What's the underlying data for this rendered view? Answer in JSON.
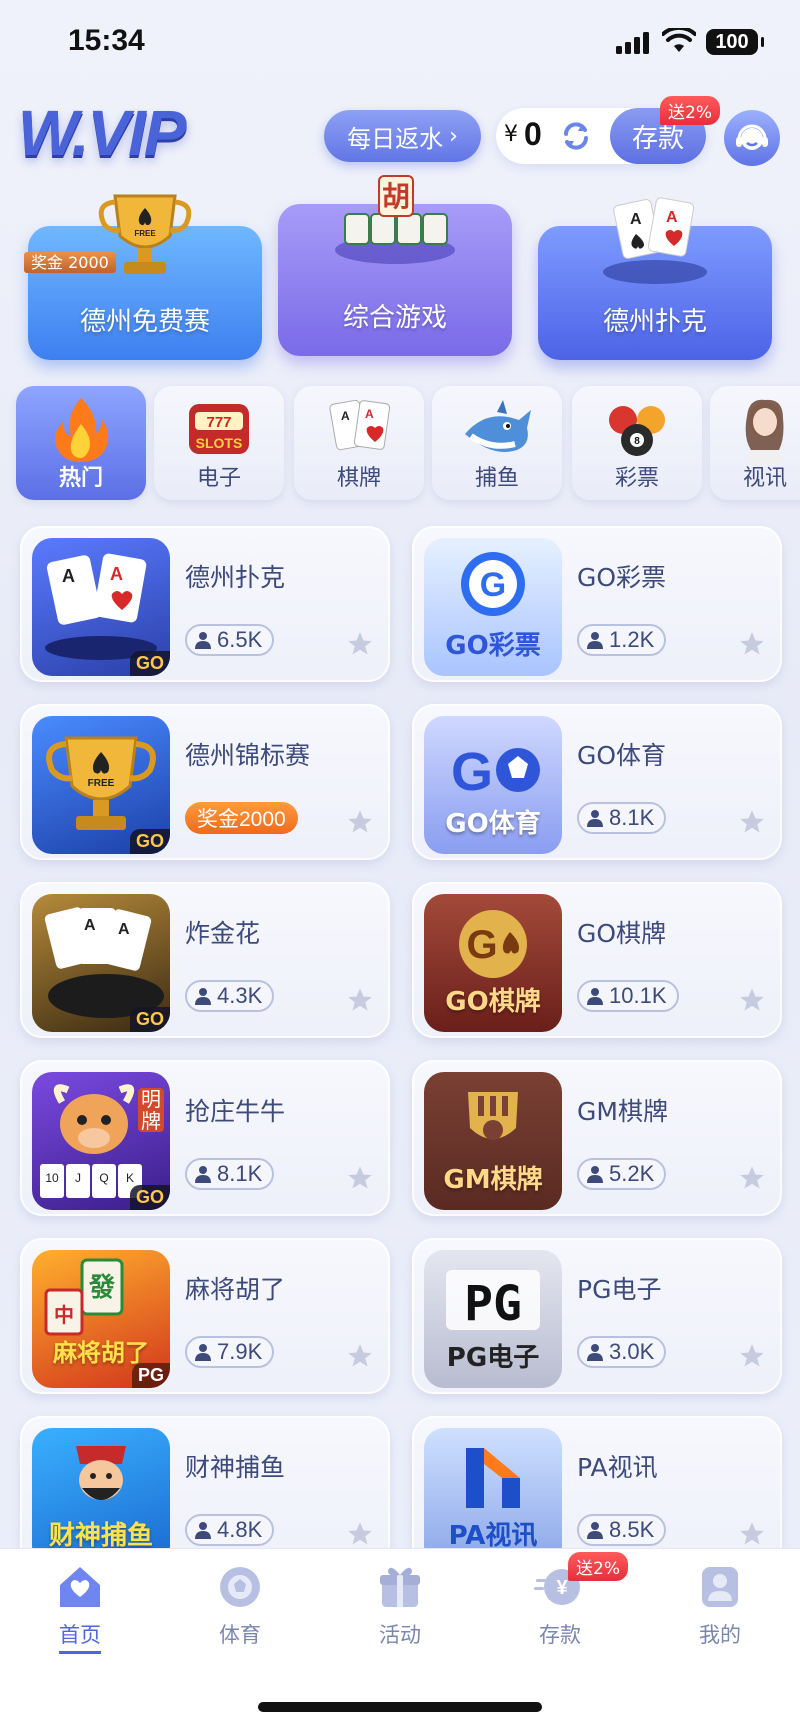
{
  "status_bar": {
    "time": "15:34",
    "battery": "100"
  },
  "header": {
    "logo": "W.VIP",
    "rebate_label": "每日返水",
    "currency": "¥",
    "balance": "0",
    "deposit_label": "存款",
    "deposit_promo": "送2%"
  },
  "featured": [
    {
      "label": "德州免费赛",
      "bonus_tag": "奖金 2000"
    },
    {
      "label": "综合游戏"
    },
    {
      "label": "德州扑克"
    }
  ],
  "categories": [
    {
      "label": "热门",
      "icon": "flame-icon",
      "active": true
    },
    {
      "label": "电子",
      "icon": "slots-icon"
    },
    {
      "label": "棋牌",
      "icon": "cards-icon"
    },
    {
      "label": "捕鱼",
      "icon": "shark-icon"
    },
    {
      "label": "彩票",
      "icon": "lottery-balls-icon"
    },
    {
      "label": "视讯",
      "icon": "live-dealer-icon"
    }
  ],
  "games": [
    {
      "name": "德州扑克",
      "count": "6.5K",
      "thumb_text": "",
      "thumb_tag": "GO"
    },
    {
      "name": "GO彩票",
      "count": "1.2K",
      "thumb_text": "GO彩票"
    },
    {
      "name": "德州锦标赛",
      "prize": "奖金2000",
      "thumb_tag": "GO"
    },
    {
      "name": "GO体育",
      "count": "8.1K",
      "thumb_text": "GO体育"
    },
    {
      "name": "炸金花",
      "count": "4.3K",
      "thumb_tag": "GO"
    },
    {
      "name": "GO棋牌",
      "count": "10.1K",
      "thumb_text": "GO棋牌"
    },
    {
      "name": "抢庄牛牛",
      "count": "8.1K",
      "thumb_tag": "GO",
      "thumb_side": "明牌"
    },
    {
      "name": "GM棋牌",
      "count": "5.2K",
      "thumb_text": "GM棋牌"
    },
    {
      "name": "麻将胡了",
      "count": "7.9K",
      "thumb_text": "麻将胡了",
      "thumb_tag": "PG"
    },
    {
      "name": "PG电子",
      "count": "3.0K",
      "thumb_text": "PG电子"
    },
    {
      "name": "财神捕鱼",
      "count": "4.8K",
      "thumb_text": "财神捕鱼"
    },
    {
      "name": "PA视讯",
      "count": "8.5K",
      "thumb_text": "PA视讯"
    }
  ],
  "bottom_nav": [
    {
      "label": "首页",
      "icon": "home-icon",
      "active": true
    },
    {
      "label": "体育",
      "icon": "sports-ball-icon"
    },
    {
      "label": "活动",
      "icon": "gift-icon"
    },
    {
      "label": "存款",
      "icon": "deposit-icon",
      "promo": "送2%"
    },
    {
      "label": "我的",
      "icon": "profile-icon"
    }
  ],
  "colors": {
    "accent": "#4f66e0",
    "promo_red": "#e62f3c",
    "prize_orange": "#f06a1c"
  }
}
